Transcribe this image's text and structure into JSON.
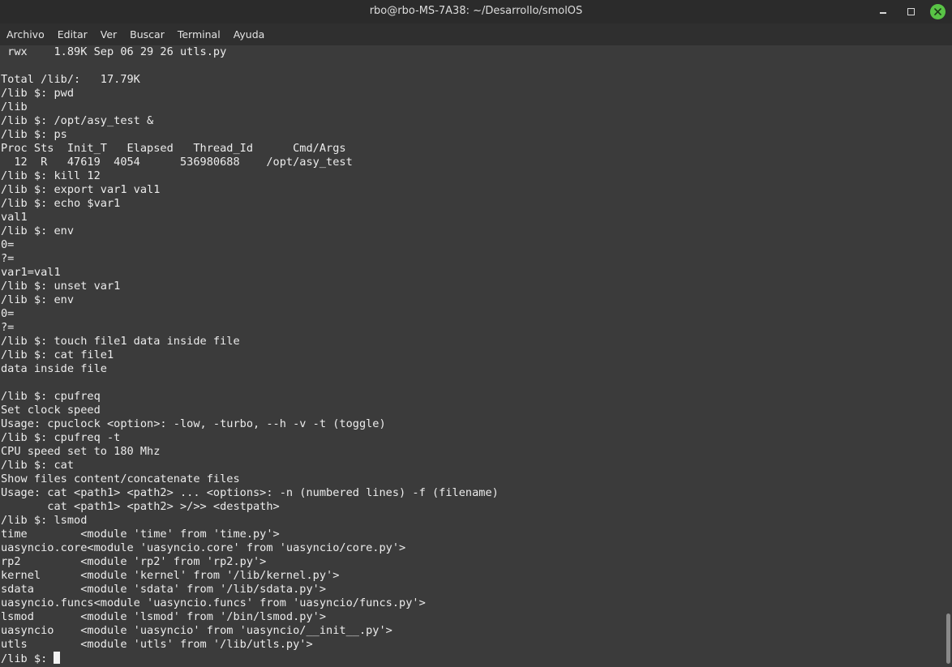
{
  "window": {
    "title": "rbo@rbo-MS-7A38: ~/Desarrollo/smolOS"
  },
  "menu": {
    "items": [
      "Archivo",
      "Editar",
      "Ver",
      "Buscar",
      "Terminal",
      "Ayuda"
    ]
  },
  "terminal": {
    "lines": [
      " rwx    1.89K Sep 06 29 26 utls.py",
      "",
      "Total /lib/:   17.79K",
      "/lib $: pwd",
      "/lib",
      "/lib $: /opt/asy_test &",
      "/lib $: ps",
      "Proc Sts  Init_T   Elapsed   Thread_Id      Cmd/Args",
      "  12  R   47619  4054      536980688    /opt/asy_test",
      "/lib $: kill 12",
      "/lib $: export var1 val1",
      "/lib $: echo $var1",
      "val1",
      "/lib $: env",
      "0=",
      "?=",
      "var1=val1",
      "/lib $: unset var1",
      "/lib $: env",
      "0=",
      "?=",
      "/lib $: touch file1 data inside file",
      "/lib $: cat file1",
      "data inside file",
      "",
      "/lib $: cpufreq",
      "Set clock speed",
      "Usage: cpuclock <option>: -low, -turbo, --h -v -t (toggle)",
      "/lib $: cpufreq -t",
      "CPU speed set to 180 Mhz",
      "/lib $: cat",
      "Show files content/concatenate files",
      "Usage: cat <path1> <path2> ... <options>: -n (numbered lines) -f (filename)",
      "       cat <path1> <path2> >/>> <destpath>",
      "/lib $: lsmod",
      "time        <module 'time' from 'time.py'>",
      "uasyncio.core<module 'uasyncio.core' from 'uasyncio/core.py'>",
      "rp2         <module 'rp2' from 'rp2.py'>",
      "kernel      <module 'kernel' from '/lib/kernel.py'>",
      "sdata       <module 'sdata' from '/lib/sdata.py'>",
      "uasyncio.funcs<module 'uasyncio.funcs' from 'uasyncio/funcs.py'>",
      "lsmod       <module 'lsmod' from '/bin/lsmod.py'>",
      "uasyncio    <module 'uasyncio' from 'uasyncio/__init__.py'>",
      "utls        <module 'utls' from '/lib/utls.py'>"
    ],
    "prompt": "/lib $: "
  },
  "colors": {
    "background": "#3b3b3b",
    "text": "#ececec",
    "titlebar": "#2b2b2b",
    "menubar": "#2f2f2f",
    "close_button": "#59c446"
  }
}
